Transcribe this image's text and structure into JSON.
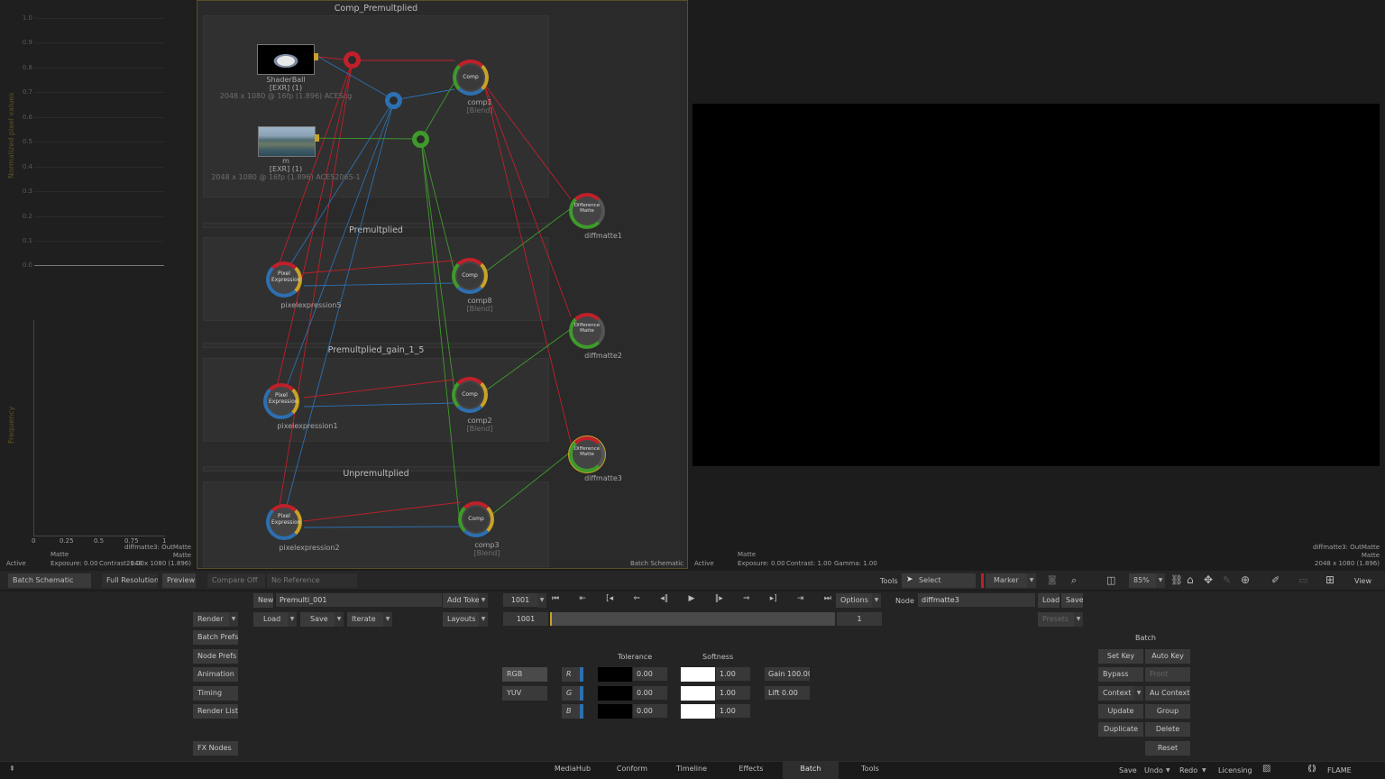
{
  "histogram": {
    "y_ticks": [
      "1.0",
      "0.9",
      "0.8",
      "0.7",
      "0.6",
      "0.5",
      "0.4",
      "0.3",
      "0.2",
      "0.1",
      "0.0"
    ],
    "ylabel_top": "Normalized pixel values",
    "ylabel_bottom": "Frequency",
    "x_ticks": [
      "0",
      "0.25",
      "0.5",
      "0.75",
      "1"
    ],
    "x_label": "Matte",
    "node_name": "diffmatte3: OutMatte",
    "channel": "Matte",
    "resolution": "2048 x 1080 (1.896)",
    "status": "Active",
    "exposure": "Exposure: 0.00",
    "contrast": "Contrast: 1.00"
  },
  "schematic": {
    "groups": [
      "Comp_Premultplied",
      "Premultplied",
      "Premultplied_gain_1_5",
      "Unpremultplied"
    ],
    "nodes": {
      "shaderball": {
        "name": "ShaderBall",
        "type": "[EXR] (1)",
        "info": "2048 x 1080 @ 16fp (1.896)  ACEScg"
      },
      "m": {
        "name": "m",
        "type": "[EXR] (1)",
        "info": "2048 x 1080 @ 16fp (1.896)  ACES2065-1"
      },
      "comp1": {
        "name": "comp1",
        "mode": "[Blend]",
        "core": "Comp"
      },
      "comp8": {
        "name": "comp8",
        "mode": "[Blend]",
        "core": "Comp"
      },
      "comp2": {
        "name": "comp2",
        "mode": "[Blend]",
        "core": "Comp"
      },
      "comp3": {
        "name": "comp3",
        "mode": "[Blend]",
        "core": "Comp"
      },
      "pixelexpression5": {
        "name": "pixelexpression5",
        "core1": "Pixel",
        "core2": "Expression"
      },
      "pixelexpression1": {
        "name": "pixelexpression1",
        "core1": "Pixel",
        "core2": "Expression"
      },
      "pixelexpression2": {
        "name": "pixelexpression2",
        "core1": "Pixel",
        "core2": "Expression"
      },
      "diffmatte1": {
        "name": "diffmatte1",
        "core1": "Difference",
        "core2": "Matte"
      },
      "diffmatte2": {
        "name": "diffmatte2",
        "core1": "Difference",
        "core2": "Matte"
      },
      "diffmatte3": {
        "name": "diffmatte3",
        "core1": "Difference",
        "core2": "Matte"
      }
    },
    "footer": "Batch Schematic",
    "colors": {
      "red": "#c0202a",
      "blue": "#2d6fb0",
      "green": "#3f9a2c",
      "accent": "#c9a227"
    }
  },
  "viewer": {
    "node_name": "diffmatte3: OutMatte",
    "channel": "Matte",
    "resolution": "2048 x 1080 (1.896)",
    "status": "Active",
    "matte": "Matte",
    "exposure": "Exposure: 0.00",
    "contrast": "Contrast: 1.00",
    "gamma": "Gamma: 1.00"
  },
  "viewbar": {
    "batch_schematic": "Batch Schematic",
    "full_resolution": "Full Resolution",
    "preview": "Preview",
    "compare_off": "Compare Off",
    "no_reference": "No Reference",
    "tools": "Tools",
    "select": "Select",
    "marker": "Marker",
    "zoom": "85%",
    "view": "View"
  },
  "controls": {
    "left_buttons": [
      "Render",
      "Batch Prefs",
      "Node Prefs",
      "Animation",
      "Timing",
      "Render List",
      "FX Nodes"
    ],
    "new": "New",
    "batch_name": "Premulti_001",
    "add_token": "Add Token",
    "load": "Load",
    "save": "Save",
    "iterate": "Iterate",
    "layouts": "Layouts",
    "frame": "1001",
    "frame_start": "1001",
    "frame_end": "1",
    "options": "Options",
    "node_label": "Node",
    "node_name": "diffmatte3",
    "node_load": "Load",
    "node_save": "Save",
    "presets": "Presets",
    "tolerance": "Tolerance",
    "softness": "Softness",
    "rgb": "RGB",
    "yuv": "YUV",
    "channels": [
      {
        "ch": "R",
        "tol": "0.00",
        "soft": "1.00"
      },
      {
        "ch": "G",
        "tol": "0.00",
        "soft": "1.00"
      },
      {
        "ch": "B",
        "tol": "0.00",
        "soft": "1.00"
      }
    ],
    "gain": "Gain 100.00",
    "lift": "Lift 0.00",
    "batch_title": "Batch",
    "set_key": "Set Key",
    "auto_key": "Auto Key",
    "bypass": "Bypass",
    "front": "Front",
    "context": "Context",
    "au_context": "Au Context",
    "update": "Update",
    "group": "Group",
    "duplicate": "Duplicate",
    "delete": "Delete",
    "reset": "Reset"
  },
  "bottom": {
    "tabs": [
      "MediaHub",
      "Conform",
      "Timeline",
      "Effects",
      "Batch",
      "Tools"
    ],
    "active_tab": "Batch",
    "save": "Save",
    "undo": "Undo",
    "redo": "Redo",
    "licensing": "Licensing",
    "brand": "FLAME",
    "up_arrow": "⇞"
  }
}
